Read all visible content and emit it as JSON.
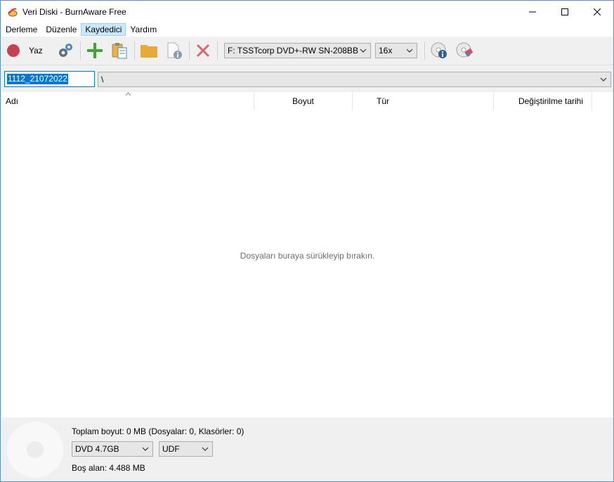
{
  "window": {
    "title": "Veri Diski - BurnAware Free"
  },
  "menu": {
    "items": [
      "Derleme",
      "Düzenle",
      "Kaydedici",
      "Yardım"
    ]
  },
  "toolbar": {
    "write_label": "Yaz",
    "drive": "F: TSSTcorp DVD+-RW SN-208BB",
    "speed": "16x"
  },
  "path": {
    "disc_label": "1112_21072022",
    "current": "\\"
  },
  "list": {
    "columns": [
      "Adı",
      "Boyut",
      "Tür",
      "Değiştirilme tarihi"
    ],
    "empty_text": "Dosyaları buraya sürükleyip bırakın."
  },
  "status": {
    "total": "Toplam boyut: 0 MB (Dosyalar: 0, Klasörler: 0)",
    "disc_type": "DVD 4.7GB",
    "filesystem": "UDF",
    "free": "Boş alan: 4.488 MB"
  },
  "colors": {
    "record": "#c8414e",
    "add": "#3fa535",
    "folder": "#e8a93b",
    "delete": "#d9676a",
    "accent": "#0078d7"
  }
}
